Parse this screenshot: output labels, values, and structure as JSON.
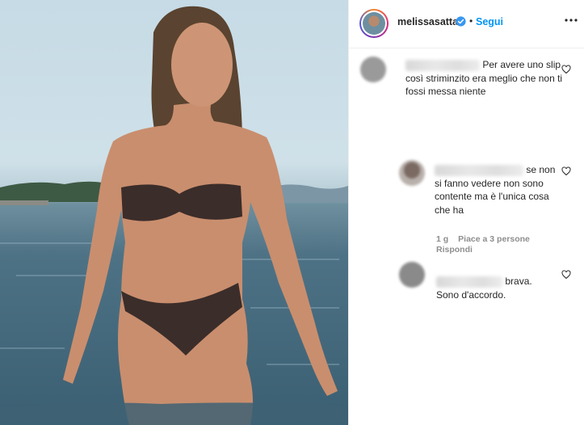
{
  "post": {
    "username": "melissasatta",
    "follow_label": "Segui",
    "separator": "•"
  },
  "comments": [
    {
      "text": "Per avere uno slip così striminzito era meglio che non ti fossi messa niente"
    },
    {
      "text": "se non si fanno vedere non sono contente ma è l'unica cosa che ha",
      "time": "1 g",
      "likes": "Piace a 3 persone",
      "reply": "Rispondi"
    },
    {
      "text": "brava. Sono d'accordo."
    }
  ],
  "icons": {
    "verified": "verified-badge-icon",
    "more": "more-options-icon",
    "heart": "heart-outline-icon"
  },
  "colors": {
    "accent": "#0095f6",
    "text": "#262626",
    "muted": "#8e8e8e"
  }
}
